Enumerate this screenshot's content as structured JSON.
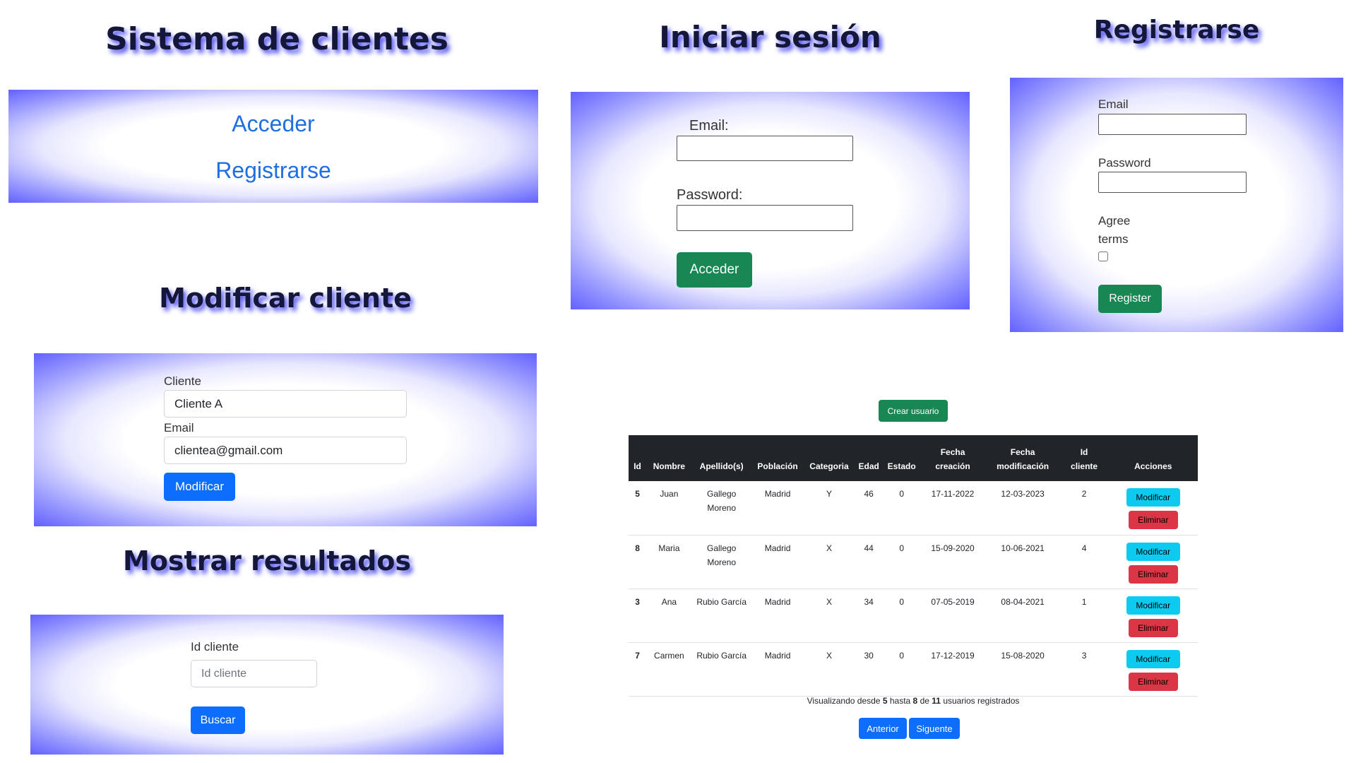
{
  "home": {
    "title": "Sistema de clientes",
    "link_acceder": "Acceder",
    "link_registrarse": "Registrarse"
  },
  "login": {
    "title": "Iniciar sesión",
    "email_label": "Email:",
    "password_label": "Password:",
    "submit_label": "Acceder"
  },
  "register": {
    "title": "Registrarse",
    "email_label": "Email",
    "password_label": "Password",
    "agree_label_1": "Agree",
    "agree_label_2": "terms",
    "submit_label": "Register"
  },
  "modify": {
    "title": "Modificar cliente",
    "client_label": "Cliente",
    "client_value": "Cliente A",
    "email_label": "Email",
    "email_value": "clientea@gmail.com",
    "submit_label": "Modificar"
  },
  "results": {
    "title": "Mostrar resultados",
    "id_label": "Id cliente",
    "id_placeholder": "Id cliente",
    "submit_label": "Buscar"
  },
  "users": {
    "create_label": "Crear usuario",
    "headers": {
      "id": "Id",
      "nombre": "Nombre",
      "apellidos": "Apellido(s)",
      "poblacion": "Población",
      "categoria": "Categoria",
      "edad": "Edad",
      "estado": "Estado",
      "fecha_creacion_1": "Fecha",
      "fecha_creacion_2": "creación",
      "fecha_mod_1": "Fecha",
      "fecha_mod_2": "modificación",
      "id_cliente_1": "Id",
      "id_cliente_2": "cliente",
      "acciones": "Acciones"
    },
    "rows": [
      {
        "id": "5",
        "nombre": "Juan",
        "apellidos_1": "Gallego",
        "apellidos_2": "Moreno",
        "poblacion": "Madrid",
        "categoria": "Y",
        "edad": "46",
        "estado": "0",
        "creacion": "17-11-2022",
        "modificacion": "12-03-2023",
        "id_cliente": "2"
      },
      {
        "id": "8",
        "nombre": "Maria",
        "apellidos_1": "Gallego",
        "apellidos_2": "Moreno",
        "poblacion": "Madrid",
        "categoria": "X",
        "edad": "44",
        "estado": "0",
        "creacion": "15-09-2020",
        "modificacion": "10-06-2021",
        "id_cliente": "4"
      },
      {
        "id": "3",
        "nombre": "Ana",
        "apellidos_1": "Rubio García",
        "apellidos_2": "",
        "poblacion": "Madrid",
        "categoria": "X",
        "edad": "34",
        "estado": "0",
        "creacion": "07-05-2019",
        "modificacion": "08-04-2021",
        "id_cliente": "1"
      },
      {
        "id": "7",
        "nombre": "Carmen",
        "apellidos_1": "Rubio García",
        "apellidos_2": "",
        "poblacion": "Madrid",
        "categoria": "X",
        "edad": "30",
        "estado": "0",
        "creacion": "17-12-2019",
        "modificacion": "15-08-2020",
        "id_cliente": "3"
      }
    ],
    "modify_label": "Modificar",
    "delete_label": "Eliminar",
    "pagination": {
      "text_1": "Visualizando desde",
      "from": "5",
      "text_2": "hasta",
      "to": "8",
      "text_3": "de",
      "total": "11",
      "text_4": "usuarios registrados",
      "prev_label": "Anterior",
      "next_label": "Siguente"
    }
  },
  "colors": {
    "panel_edge": "#6161ff",
    "link": "#1f6fe0",
    "btn_green": "#198754",
    "btn_blue": "#0d6efd",
    "btn_cyan": "#0dcaf0",
    "btn_red": "#dc3545",
    "table_header": "#212529"
  }
}
